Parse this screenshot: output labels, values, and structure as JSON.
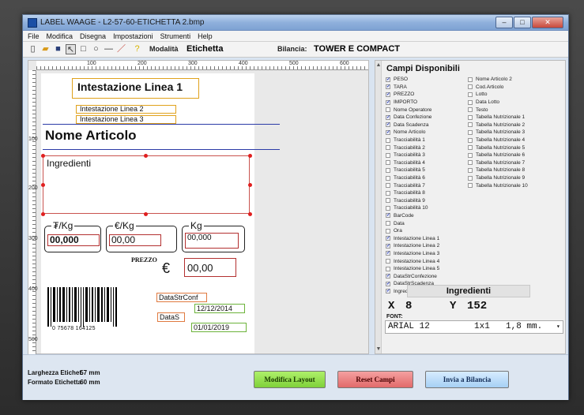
{
  "window": {
    "title": "LABEL WAAGE - L2-57-60-ETICHETTA 2.bmp"
  },
  "menu": [
    "File",
    "Modifica",
    "Disegna",
    "Impostazioni",
    "Strumenti",
    "Help"
  ],
  "toolbar": {
    "modalita_label": "Modalità",
    "modalita_value": "Etichetta",
    "bilancia_label": "Bilancia:",
    "bilancia_value": "TOWER E COMPACT"
  },
  "ruler": {
    "h_ticks": [
      "100",
      "200",
      "300",
      "400",
      "500",
      "600"
    ],
    "v_ticks": [
      "100",
      "200",
      "300",
      "400",
      "500"
    ]
  },
  "label": {
    "header1": "Intestazione Linea 1",
    "header2": "Intestazione Linea 2",
    "header3": "Intestazione Linea 3",
    "nome_articolo": "Nome Articolo",
    "ingredienti": "Ingredienti",
    "price_per_kg_label": "₮/Kg",
    "price_per_kg_value": "00,000",
    "euro_per_kg_label": "€/Kg",
    "euro_per_kg_value": "00,00",
    "kg_label": "Kg",
    "kg_value": "00,000",
    "prezzo_label": "PREZZO",
    "euro_sign": "€",
    "prezzo_value": "00,00",
    "barcode_text": "0 75678 164125",
    "data_str_conf": "DataStrConf",
    "date1": "12/12/2014",
    "data_s": "DataS",
    "date2": "01/01/2019"
  },
  "fields_panel": {
    "title": "Campi Disponibili",
    "col1": [
      {
        "label": "PESO",
        "checked": true
      },
      {
        "label": "TARA",
        "checked": true
      },
      {
        "label": "PREZZO",
        "checked": true
      },
      {
        "label": "IMPORTO",
        "checked": true
      },
      {
        "label": "Nome Operatore",
        "checked": false
      },
      {
        "label": "Data Confezione",
        "checked": true
      },
      {
        "label": "Data Scadenza",
        "checked": true
      },
      {
        "label": "Nome Articolo",
        "checked": true
      },
      {
        "label": "Tracciabilità 1",
        "checked": false
      },
      {
        "label": "Tracciabilità 2",
        "checked": false
      },
      {
        "label": "Tracciabilità 3",
        "checked": false
      },
      {
        "label": "Tracciabilità 4",
        "checked": false
      },
      {
        "label": "Tracciabilità 5",
        "checked": false
      },
      {
        "label": "Tracciabilità 6",
        "checked": false
      },
      {
        "label": "Tracciabilità 7",
        "checked": false
      },
      {
        "label": "Tracciabilità 8",
        "checked": false
      },
      {
        "label": "Tracciabilità 9",
        "checked": false
      },
      {
        "label": "Tracciabilità 10",
        "checked": false
      },
      {
        "label": "BarCode",
        "checked": true
      },
      {
        "label": "Data",
        "checked": false
      },
      {
        "label": "Ora",
        "checked": false
      },
      {
        "label": "Intestazione Linea 1",
        "checked": true
      },
      {
        "label": "Intestazione Linea 2",
        "checked": true
      },
      {
        "label": "Intestazione Linea 3",
        "checked": true
      },
      {
        "label": "Intestazione Linea 4",
        "checked": false
      },
      {
        "label": "Intestazione Linea 5",
        "checked": false
      },
      {
        "label": "DataStrConfezione",
        "checked": true
      },
      {
        "label": "DataStrScadenza",
        "checked": true
      },
      {
        "label": "Ingredienti",
        "checked": true
      }
    ],
    "col2": [
      {
        "label": "Nome Articolo 2",
        "checked": false
      },
      {
        "label": "Cod.Articolo",
        "checked": false
      },
      {
        "label": "Lotto",
        "checked": false
      },
      {
        "label": "Data Lotto",
        "checked": false
      },
      {
        "label": "Testo",
        "checked": false
      },
      {
        "label": "Tabella Nutrizionale 1",
        "checked": false
      },
      {
        "label": "Tabella Nutrizionale 2",
        "checked": false
      },
      {
        "label": "Tabella Nutrizionale 3",
        "checked": false
      },
      {
        "label": "Tabella Nutrizionale 4",
        "checked": false
      },
      {
        "label": "Tabella Nutrizionale 5",
        "checked": false
      },
      {
        "label": "Tabella Nutrizionale 6",
        "checked": false
      },
      {
        "label": "Tabella Nutrizionale 7",
        "checked": false
      },
      {
        "label": "Tabella Nutrizionale 8",
        "checked": false
      },
      {
        "label": "Tabella Nutrizionale 9",
        "checked": false
      },
      {
        "label": "Tabella Nutrizionale 10",
        "checked": false
      }
    ]
  },
  "selection": {
    "name": "Ingredienti",
    "x_label": "X",
    "x_value": "8",
    "y_label": "Y",
    "y_value": "152",
    "font_label": "FONT:",
    "font_name": "ARIAL 12",
    "font_scale": "1x1",
    "font_size": "1,8 mm."
  },
  "bottom": {
    "larghezza_label": "Larghezza Etichet.",
    "larghezza_value": "57",
    "formato_label": "Formato Etichetta",
    "formato_value": "60",
    "unit": "mm",
    "btn_modifica": "Modifica Layout",
    "btn_reset": "Reset Campi",
    "btn_invia": "Invia a Bilancia"
  }
}
